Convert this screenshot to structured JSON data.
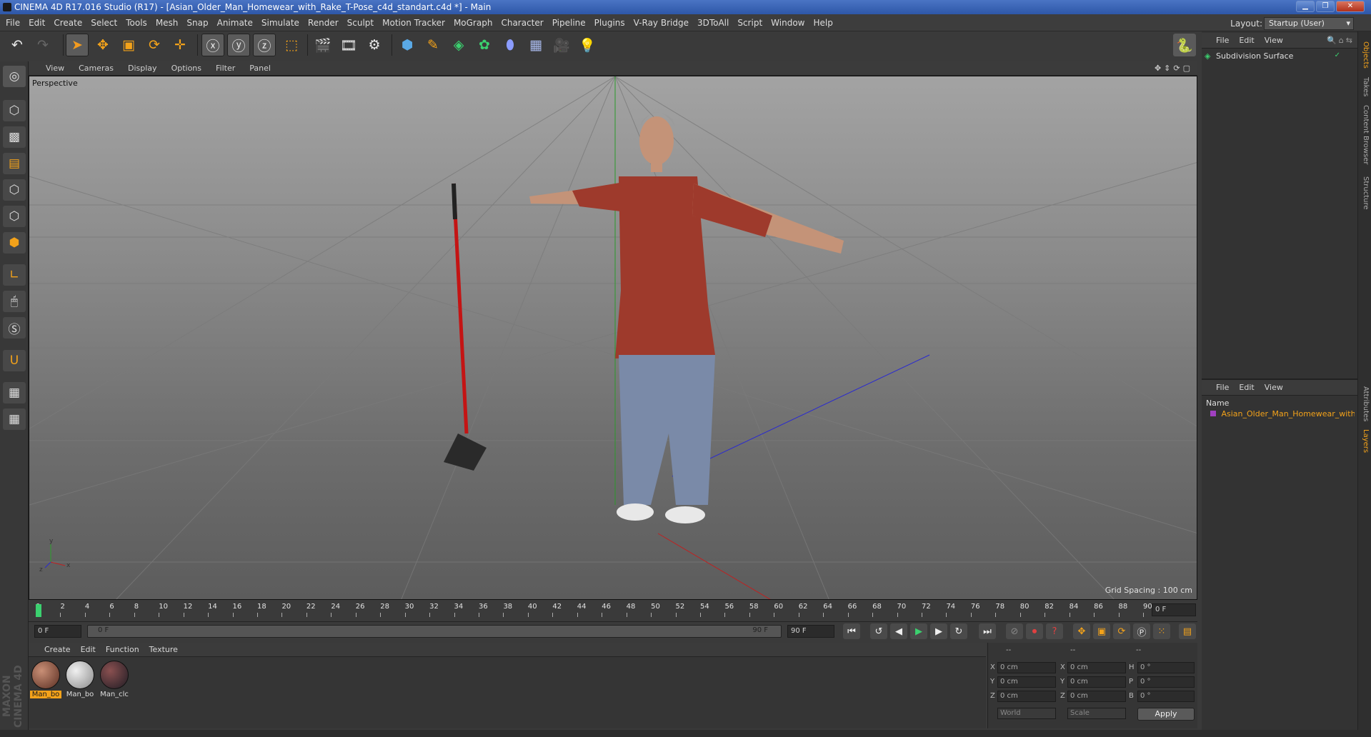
{
  "window": {
    "title": "CINEMA 4D R17.016 Studio (R17) - [Asian_Older_Man_Homewear_with_Rake_T-Pose_c4d_standart.c4d *] - Main",
    "controls": [
      "minimize",
      "maximize",
      "close"
    ]
  },
  "menu": [
    "File",
    "Edit",
    "Create",
    "Select",
    "Tools",
    "Mesh",
    "Snap",
    "Animate",
    "Simulate",
    "Render",
    "Sculpt",
    "Motion Tracker",
    "MoGraph",
    "Character",
    "Pipeline",
    "Plugins",
    "V-Ray Bridge",
    "3DToAll",
    "Script",
    "Window",
    "Help"
  ],
  "layout": {
    "label": "Layout:",
    "value": "Startup (User)"
  },
  "viewport": {
    "menu": [
      "View",
      "Cameras",
      "Display",
      "Options",
      "Filter",
      "Panel"
    ],
    "camera": "Perspective",
    "grid_spacing": "Grid Spacing : 100 cm",
    "axis_labels": {
      "x": "x",
      "y": "y",
      "z": "z"
    }
  },
  "timeline": {
    "ticks": [
      "0",
      "2",
      "4",
      "6",
      "8",
      "10",
      "12",
      "14",
      "16",
      "18",
      "20",
      "22",
      "24",
      "26",
      "28",
      "30",
      "32",
      "34",
      "36",
      "38",
      "40",
      "42",
      "44",
      "46",
      "48",
      "50",
      "52",
      "54",
      "56",
      "58",
      "60",
      "62",
      "64",
      "66",
      "68",
      "70",
      "72",
      "74",
      "76",
      "78",
      "80",
      "82",
      "84",
      "86",
      "88",
      "90"
    ],
    "current_frame": "0 F",
    "start": "0 F",
    "range_start": "0 F",
    "range_end": "90 F",
    "end": "90 F"
  },
  "materials": {
    "menu": [
      "Create",
      "Edit",
      "Function",
      "Texture"
    ],
    "items": [
      {
        "label": "Man_bo",
        "active": true,
        "color": "#6a3a2c"
      },
      {
        "label": "Man_bo",
        "active": false,
        "color": "#b5b5b5"
      },
      {
        "label": "Man_clc",
        "active": false,
        "color": "#4a2a2a"
      }
    ]
  },
  "coords": {
    "headers": [
      "--",
      "--",
      "--"
    ],
    "rows": [
      {
        "a": "X",
        "av": "0 cm",
        "b": "X",
        "bv": "0 cm",
        "c": "H",
        "cv": "0 °"
      },
      {
        "a": "Y",
        "av": "0 cm",
        "b": "Y",
        "bv": "0 cm",
        "c": "P",
        "cv": "0 °"
      },
      {
        "a": "Z",
        "av": "0 cm",
        "b": "Z",
        "bv": "0 cm",
        "c": "B",
        "cv": "0 °"
      }
    ],
    "mode": "World",
    "transform": "Scale",
    "apply": "Apply"
  },
  "objects": {
    "menu": [
      "File",
      "Edit",
      "View"
    ],
    "items": [
      {
        "name": "Subdivision Surface"
      }
    ]
  },
  "layers": {
    "menu": [
      "File",
      "Edit",
      "View"
    ],
    "header": "Name",
    "items": [
      {
        "name": "Asian_Older_Man_Homewear_with"
      }
    ]
  },
  "side_tabs": [
    "Objects",
    "Takes",
    "Content Browser",
    "Structure",
    "Attributes",
    "Layers"
  ],
  "brand": "MAXON CINEMA 4D"
}
